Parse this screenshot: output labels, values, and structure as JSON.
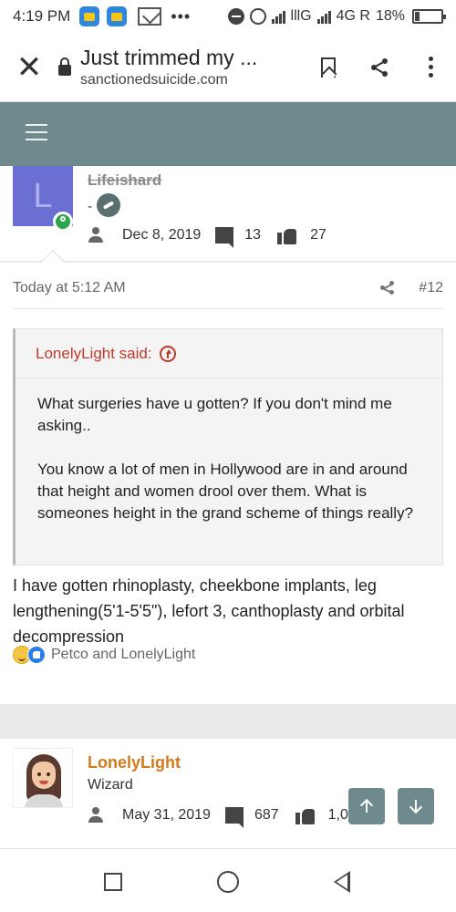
{
  "status_bar": {
    "time": "4:19 PM",
    "network1": "lllG",
    "network2": "4G R",
    "battery": "18%"
  },
  "browser": {
    "close_icon": "close-icon",
    "title": "Just trimmed my ...",
    "url": "sanctionedsuicide.com",
    "bookmark_icon": "bookmark-icon",
    "share_icon": "share-icon",
    "menu_icon": "more-vert-icon"
  },
  "site_header": {
    "menu_icon": "hamburger-icon",
    "accent_color": "#6f8a8c"
  },
  "post": {
    "author": {
      "avatar_letter": "L",
      "username": "Lifeishard",
      "role_prefix": "-",
      "joined": "Dec 8, 2019",
      "messages": "13",
      "reactions": "27"
    },
    "timestamp": "Today at 5:12 AM",
    "number": "#12",
    "quote": {
      "author_label": "LonelyLight said:",
      "paragraphs": [
        "What surgeries have u gotten? If you don't mind me asking..",
        "You know a lot of men in Hollywood are in and around that height and women drool over them. What is someones height in the grand scheme of things really?"
      ]
    },
    "body": "I have gotten rhinoplasty, cheekbone implants, leg lengthening(5'1-5'5\"), lefort 3, canthoplasty and orbital decompression",
    "reaction_summary": "Petco and LonelyLight"
  },
  "next_post": {
    "author": {
      "username": "LonelyLight",
      "role": "Wizard",
      "joined": "May 31, 2019",
      "messages": "687",
      "reactions": "1,0"
    }
  },
  "navigation": {
    "scroll_up_icon": "arrow-up-icon",
    "scroll_down_icon": "arrow-down-icon"
  },
  "system_nav": {
    "recents_icon": "square-icon",
    "home_icon": "circle-icon",
    "back_icon": "triangle-back-icon"
  }
}
